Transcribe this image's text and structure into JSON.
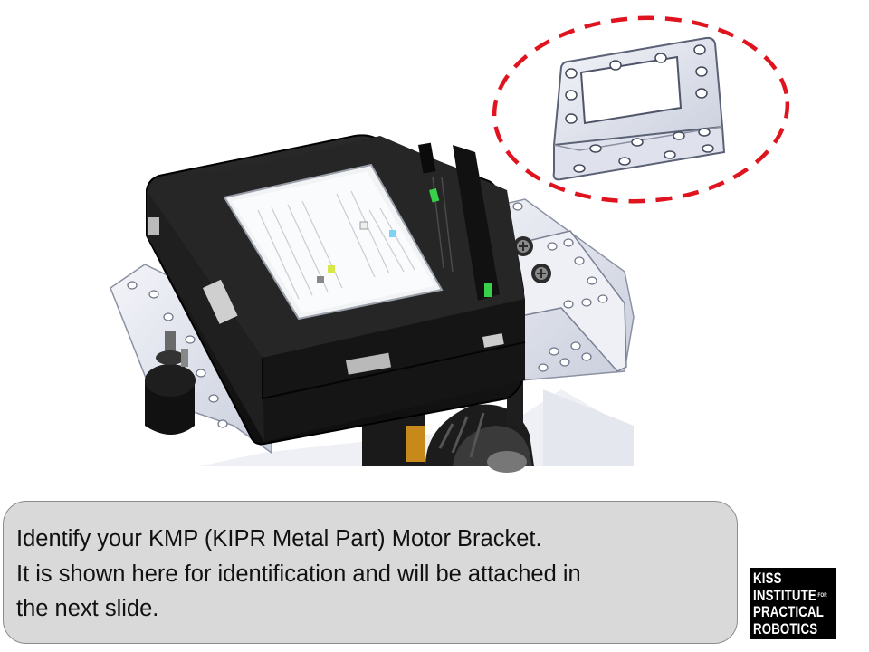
{
  "caption": {
    "lines": [
      "Identify your KMP (KIPR Metal Part) Motor Bracket.",
      "It is shown here for identification  and will be attached in",
      "the next slide."
    ]
  },
  "logo": {
    "line1": "KISS",
    "line2": "INSTITUTE",
    "for": "FOR",
    "line3": "PRACTICAL",
    "line4": "ROBOTICS"
  },
  "colors": {
    "highlight": "#e0141e",
    "caption_bg": "#d9d9d9",
    "controller_body": "#1c1c1c",
    "metal": "#d6dae6"
  }
}
